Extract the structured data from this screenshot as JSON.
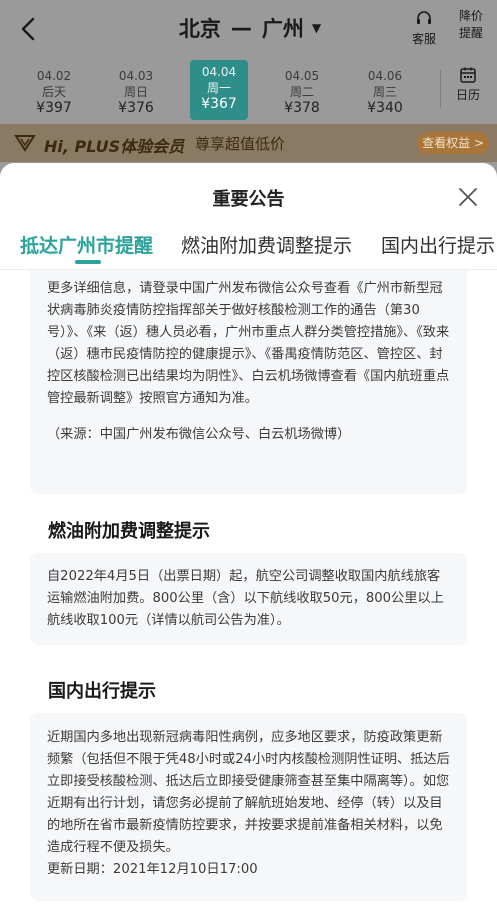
{
  "header": {
    "from_city": "北京",
    "separator": "—",
    "to_city": "广州",
    "caret": "▼",
    "kefu_label": "客服",
    "price_alert_label_1": "降价",
    "price_alert_label_2": "提醒"
  },
  "dates": [
    {
      "date": "04.02",
      "weekday": "后天",
      "price": "¥397"
    },
    {
      "date": "04.03",
      "weekday": "周日",
      "price": "¥376"
    },
    {
      "date": "04.04",
      "weekday": "周一",
      "price": "¥367"
    },
    {
      "date": "04.05",
      "weekday": "周二",
      "price": "¥378"
    },
    {
      "date": "04.06",
      "weekday": "周三",
      "price": "¥340"
    }
  ],
  "calendar_label": "日历",
  "plus_banner": {
    "title": "Hi, PLUS体验会员",
    "subtitle": "尊享超值低价",
    "button": "查看权益 >"
  },
  "modal": {
    "title": "重要公告",
    "tabs": [
      "抵达广州市提醒",
      "燃油附加费调整提示",
      "国内出行提示"
    ],
    "active_tab": 0,
    "card1": {
      "body": "更多详细信息，请登录中国广州发布微信公众号查看《广州市新型冠状病毒肺炎疫情防控指挥部关于做好核酸检测工作的通告（第30号）》、《来（返）穗人员必看，广州市重点人群分类管控措施》、《致来（返）穗市民疫情防控的健康提示》、《番禺疫情防范区、管控区、封控区核酸检测已出结果均为阴性》、白云机场微博查看《国内航班重点管控最新调整》按照官方通知为准。",
      "source": "（来源：中国广州发布微信公众号、白云机场微博）"
    },
    "section2": {
      "title": "燃油附加费调整提示",
      "body": "自2022年4月5日（出票日期）起，航空公司调整收取国内航线旅客运输燃油附加费。800公里（含）以下航线收取50元，800公里以上航线收取100元（详情以航司公告为准）。"
    },
    "section3": {
      "title": "国内出行提示",
      "body": "近期国内多地出现新冠病毒阳性病例，应多地区要求，防疫政策更新频繁（包括但不限于凭48小时或24小时内核酸检测阴性证明、抵达后立即接受核酸检测、抵达后立即接受健康筛查甚至集中隔离等）。如您近期有出行计划，请您务必提前了解航班始发地、经停（转）以及目的地所在省市最新疫情防控要求，并按要求提前准备相关材料，以免造成行程不便及损失。",
      "update": "更新日期：2021年12月10日17:00"
    }
  },
  "colors": {
    "accent": "#2ca39b",
    "active_date_bg": "#2f8e8a",
    "card_bg": "#f6f7f9"
  }
}
